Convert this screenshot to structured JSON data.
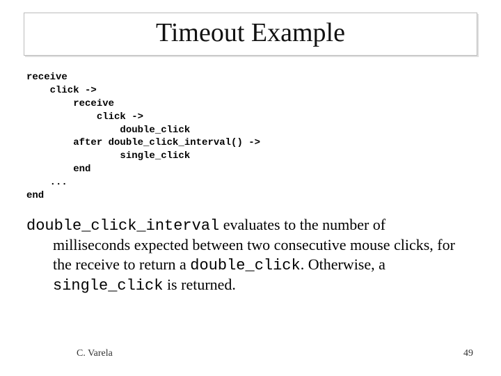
{
  "title": "Timeout Example",
  "code": "receive\n    click ->\n        receive\n            click ->\n                double_click\n        after double_click_interval() ->\n                single_click\n        end\n    ...\nend",
  "desc": {
    "t1": "double_click_interval",
    "t2": "  evaluates to the number of",
    "t3": "milliseconds expected between two consecutive mouse clicks, for the receive to return a ",
    "t4": "double_click",
    "t5": ". Otherwise, a ",
    "t6": "single_click",
    "t7": " is returned."
  },
  "footer": {
    "author": "C. Varela",
    "page": "49"
  }
}
